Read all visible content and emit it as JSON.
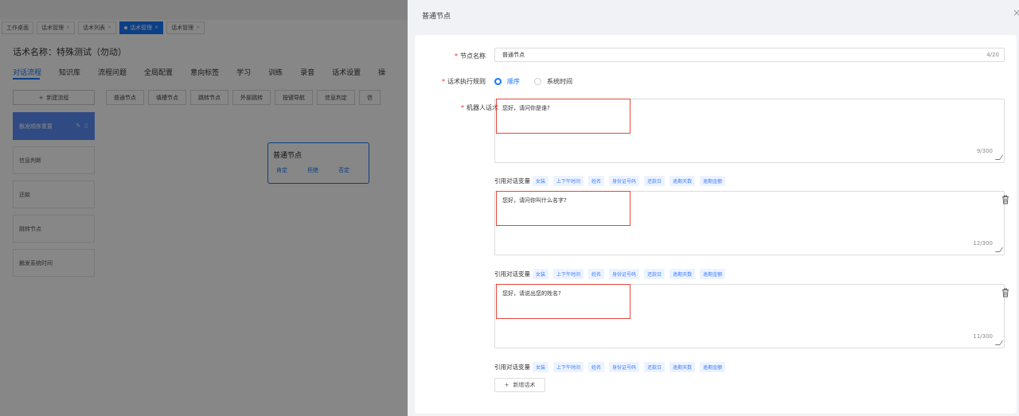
{
  "app": {
    "tabs": [
      {
        "label": "工作桌面",
        "closable": false,
        "active": false
      },
      {
        "label": "话术管理",
        "closable": true,
        "active": false
      },
      {
        "label": "话术列表",
        "closable": true,
        "active": false
      },
      {
        "label": "话术管理",
        "closable": true,
        "active": true
      },
      {
        "label": "话术管理",
        "closable": true,
        "active": false
      }
    ],
    "script_title": "话术名称：特殊测试（勿动）",
    "nav": [
      "对话流程",
      "知识库",
      "流程问题",
      "全局配置",
      "意向标签",
      "学习",
      "训练",
      "录音",
      "话术设置",
      "操"
    ],
    "new_flow_label": "新建流程",
    "node_buttons": [
      "普通节点",
      "填槽节点",
      "跳转节点",
      "外部跳转",
      "按键导航",
      "信息判定",
      "信"
    ],
    "flows": [
      "触发顺序重置",
      "信息判断",
      "还款",
      "跳转节点",
      "触发系统时间"
    ],
    "canvas_node": {
      "title": "普通节点",
      "outputs": [
        "肯定",
        "拒绝",
        "否定"
      ]
    }
  },
  "drawer": {
    "title": "普通节点",
    "close_icon": "×",
    "node_name_label": "节点名称",
    "node_name_value": "普通节点",
    "node_name_count": "4/20",
    "rule_label": "话术执行规则",
    "rule_options": [
      "顺序",
      "系统时间"
    ],
    "rule_selected": 0,
    "robot_label": "机器人话术",
    "var_label": "引用对话变量",
    "variables": [
      "女装",
      "上下午时间",
      "姓名",
      "身份证号码",
      "还款日",
      "逾期天数",
      "逾期金额"
    ],
    "scripts": [
      {
        "text": "您好，请问你是谁?",
        "count": "9/300"
      },
      {
        "text": "您好，请问你叫什么名字?",
        "count": "12/300"
      },
      {
        "text": "您好，请说出您的姓名?",
        "count": "11/300"
      }
    ],
    "add_script_label": "新增话术"
  }
}
